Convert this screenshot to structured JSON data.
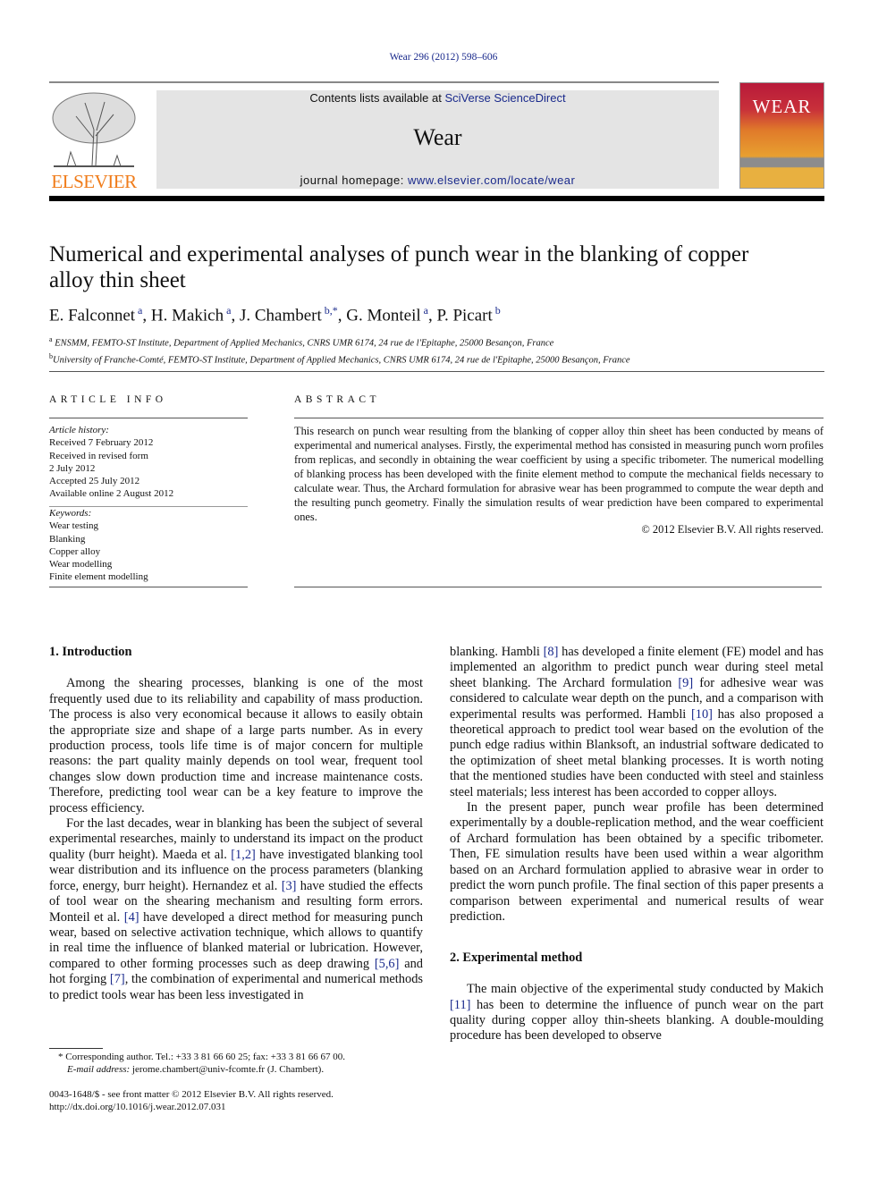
{
  "header": {
    "citation": "Wear 296 (2012) 598–606",
    "contents_prefix": "Contents lists available at ",
    "contents_link": "SciVerse ScienceDirect",
    "journal": "Wear",
    "homepage_prefix": "journal homepage: ",
    "homepage_link": "www.elsevier.com/locate/wear",
    "publisher_logo": "ELSEVIER",
    "cover_title": "WEAR"
  },
  "article": {
    "title": "Numerical and experimental analyses of punch wear in the blanking of copper alloy thin sheet",
    "authors": [
      {
        "name": "E. Falconnet",
        "sup": "a"
      },
      {
        "name": "H. Makich",
        "sup": "a"
      },
      {
        "name": "J. Chambert",
        "sup": "b,*"
      },
      {
        "name": "G. Monteil",
        "sup": "a"
      },
      {
        "name": "P. Picart",
        "sup": "b"
      }
    ],
    "affiliations": [
      {
        "sup": "a",
        "text": "ENSMM, FEMTO-ST Institute, Department of Applied Mechanics, CNRS UMR 6174, 24 rue de l'Epitaphe, 25000 Besançon, France"
      },
      {
        "sup": "b",
        "text": "University of Franche-Comté, FEMTO-ST Institute, Department of Applied Mechanics, CNRS UMR 6174, 24 rue de l'Epitaphe, 25000 Besançon, France"
      }
    ]
  },
  "article_info": {
    "heading": "ARTICLE INFO",
    "history_label": "Article history:",
    "history": [
      "Received 7 February 2012",
      "Received in revised form",
      "2 July 2012",
      "Accepted 25 July 2012",
      "Available online 2 August 2012"
    ],
    "keywords_label": "Keywords:",
    "keywords": [
      "Wear testing",
      "Blanking",
      "Copper alloy",
      "Wear modelling",
      "Finite element modelling"
    ]
  },
  "abstract": {
    "heading": "ABSTRACT",
    "text": "This research on punch wear resulting from the blanking of copper alloy thin sheet has been conducted by means of experimental and numerical analyses. Firstly, the experimental method has consisted in measuring punch worn profiles from replicas, and secondly in obtaining the wear coefficient by using a specific tribometer. The numerical modelling of blanking process has been developed with the finite element method to compute the mechanical fields necessary to calculate wear. Thus, the Archard formulation for abrasive wear has been programmed to compute the wear depth and the resulting punch geometry. Finally the simulation results of wear prediction have been compared to experimental ones.",
    "copyright": "© 2012 Elsevier B.V. All rights reserved."
  },
  "body": {
    "sec1_heading": "1.  Introduction",
    "sec1_paragraphs": [
      "Among the shearing processes, blanking is one of the most frequently used due to its reliability and capability of mass production. The process is also very economical because it allows to easily obtain the appropriate size and shape of a large parts number. As in every production process, tools life time is of major concern for multiple reasons: the part quality mainly depends on tool wear, frequent tool changes slow down production time and increase maintenance costs. Therefore, predicting tool wear can be a key feature to improve the process efficiency.",
      "For the last decades, wear in blanking has been the subject of several experimental researches, mainly to understand its impact on the product quality (burr height). Maeda et al. [1,2] have investigated blanking tool wear distribution and its influence on the process parameters (blanking force, energy, burr height). Hernandez et al. [3] have studied the effects of tool wear on the shearing mechanism and resulting form errors. Monteil et al. [4] have developed a direct method for measuring punch wear, based on selective activation technique, which allows to quantify in real time the influence of blanked material or lubrication. However, compared to other forming processes such as deep drawing [5,6] and hot forging [7], the combination of experimental and numerical methods to predict tools wear has been less investigated in"
    ],
    "sec1_right_paragraphs": [
      "blanking. Hambli [8] has developed a finite element (FE) model and has implemented an algorithm to predict punch wear during steel metal sheet blanking. The Archard formulation [9] for adhesive wear was considered to calculate wear depth on the punch, and a comparison with experimental results was performed. Hambli [10] has also proposed a theoretical approach to predict tool wear based on the evolution of the punch edge radius within Blanksoft, an industrial software dedicated to the optimization of sheet metal blanking processes. It is worth noting that the mentioned studies have been conducted with steel and stainless steel materials; less interest has been accorded to copper alloys.",
      "In the present paper, punch wear profile has been determined experimentally by a double-replication method, and the wear coefficient of Archard formulation has been obtained by a specific tribometer. Then, FE simulation results have been used within a wear algorithm based on an Archard formulation applied to abrasive wear in order to predict the worn punch profile. The final section of this paper presents a comparison between experimental and numerical results of wear prediction."
    ],
    "sec2_heading": "2.  Experimental method",
    "sec2_paragraphs": [
      "The main objective of the experimental study conducted by Makich [11] has been to determine the influence of punch wear on the part quality during copper alloy thin-sheets blanking. A double-moulding procedure has been developed to observe"
    ]
  },
  "footnotes": {
    "corresponding": "* Corresponding author. Tel.: +33 3 81 66 60 25; fax: +33 3 81 66 67 00.",
    "email_label": "E-mail address:",
    "email": "jerome.chambert@univ-fcomte.fr (J. Chambert).",
    "front_matter": "0043-1648/$ - see front matter © 2012 Elsevier B.V. All rights reserved.",
    "doi": "http://dx.doi.org/10.1016/j.wear.2012.07.031"
  },
  "colors": {
    "link": "#1a2a8c",
    "elsevier_orange": "#f07c1a",
    "banner_bg": "#e4e4e4"
  }
}
